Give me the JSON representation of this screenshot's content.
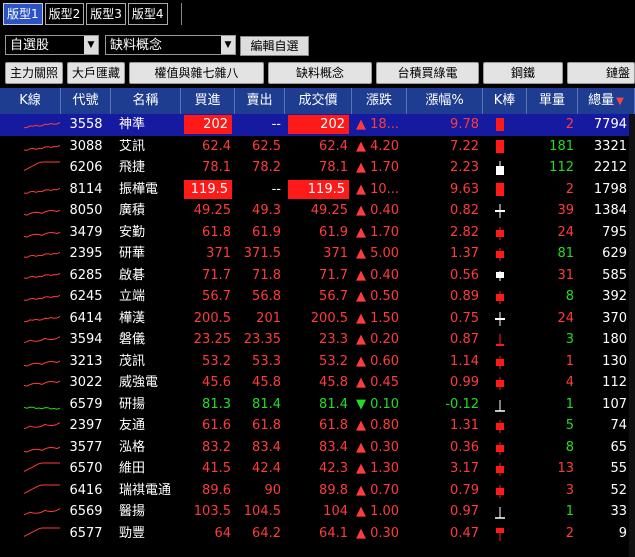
{
  "tabs": [
    "版型1",
    "版型2",
    "版型3",
    "版型4"
  ],
  "active_tab": 0,
  "selector": {
    "group": "自選股",
    "list": "缺料概念",
    "edit_label": "編輯自選"
  },
  "categories": [
    "主力關照",
    "大戶匯藏",
    "權值與雜七雜八",
    "缺料概念",
    "台積買綠電",
    "鋼鐵",
    "鏈盤"
  ],
  "columns": [
    "K線",
    "代號",
    "名稱",
    "買進",
    "賣出",
    "成交價",
    "漲跌",
    "漲幅%",
    "K棒",
    "單量",
    "總量"
  ],
  "sort_indicator": "▼",
  "colors": {
    "up": "#ff3b3b",
    "down": "#22dd22",
    "header": "#1e3d91",
    "selected": "#151aa0"
  },
  "rows": [
    {
      "code": "3558",
      "name": "神準",
      "bid": "202",
      "ask": "--",
      "last": "202",
      "chg": "▲ 18...",
      "pct": "9.78",
      "vol": "2",
      "total": "7794",
      "dir": "up",
      "limit": true,
      "kbar": "red-tall"
    },
    {
      "code": "3088",
      "name": "艾訊",
      "bid": "62.4",
      "ask": "62.5",
      "last": "62.4",
      "chg": "▲ 4.20",
      "pct": "7.22",
      "vol": "181",
      "total": "3321",
      "dir": "up",
      "volc": "green",
      "kbar": "red-tall"
    },
    {
      "code": "6206",
      "name": "飛捷",
      "bid": "78.1",
      "ask": "78.2",
      "last": "78.1",
      "chg": "▲ 1.70",
      "pct": "2.23",
      "vol": "112",
      "total": "2212",
      "dir": "up",
      "volc": "green",
      "kbar": "white-up"
    },
    {
      "code": "8114",
      "name": "振樺電",
      "bid": "119.5",
      "ask": "--",
      "last": "119.5",
      "chg": "▲ 10...",
      "pct": "9.63",
      "vol": "2",
      "total": "1798",
      "dir": "up",
      "limit": true,
      "kbar": "red-tall"
    },
    {
      "code": "8050",
      "name": "廣積",
      "bid": "49.25",
      "ask": "49.3",
      "last": "49.25",
      "chg": "▲ 0.40",
      "pct": "0.82",
      "vol": "39",
      "total": "1384",
      "dir": "up",
      "kbar": "white-cross"
    },
    {
      "code": "3479",
      "name": "安勤",
      "bid": "61.8",
      "ask": "61.9",
      "last": "61.9",
      "chg": "▲ 1.70",
      "pct": "2.82",
      "vol": "24",
      "total": "795",
      "dir": "up",
      "kbar": "red-mid"
    },
    {
      "code": "2395",
      "name": "研華",
      "bid": "371",
      "ask": "371.5",
      "last": "371",
      "chg": "▲ 5.00",
      "pct": "1.37",
      "vol": "81",
      "total": "629",
      "dir": "up",
      "volc": "green",
      "kbar": "red-mid"
    },
    {
      "code": "6285",
      "name": "啟碁",
      "bid": "71.7",
      "ask": "71.8",
      "last": "71.7",
      "chg": "▲ 0.40",
      "pct": "0.56",
      "vol": "31",
      "total": "585",
      "dir": "up",
      "kbar": "white-mid"
    },
    {
      "code": "6245",
      "name": "立端",
      "bid": "56.7",
      "ask": "56.8",
      "last": "56.7",
      "chg": "▲ 0.50",
      "pct": "0.89",
      "vol": "8",
      "total": "392",
      "dir": "up",
      "volc": "green",
      "kbar": "red-mid"
    },
    {
      "code": "6414",
      "name": "樺漢",
      "bid": "200.5",
      "ask": "201",
      "last": "200.5",
      "chg": "▲ 1.50",
      "pct": "0.75",
      "vol": "24",
      "total": "370",
      "dir": "up",
      "kbar": "white-cross"
    },
    {
      "code": "3594",
      "name": "磐儀",
      "bid": "23.25",
      "ask": "23.35",
      "last": "23.3",
      "chg": "▲ 0.20",
      "pct": "0.87",
      "vol": "3",
      "total": "180",
      "dir": "up",
      "volc": "green",
      "kbar": "red-thin"
    },
    {
      "code": "3213",
      "name": "茂訊",
      "bid": "53.2",
      "ask": "53.3",
      "last": "53.2",
      "chg": "▲ 0.60",
      "pct": "1.14",
      "vol": "1",
      "total": "130",
      "dir": "up",
      "kbar": "red-mid"
    },
    {
      "code": "3022",
      "name": "威強電",
      "bid": "45.6",
      "ask": "45.8",
      "last": "45.8",
      "chg": "▲ 0.45",
      "pct": "0.99",
      "vol": "4",
      "total": "112",
      "dir": "up",
      "kbar": "red-mid"
    },
    {
      "code": "6579",
      "name": "研揚",
      "bid": "81.3",
      "ask": "81.4",
      "last": "81.4",
      "chg": "▼ 0.10",
      "pct": "-0.12",
      "vol": "1",
      "total": "107",
      "dir": "down",
      "volc": "green",
      "kbar": "white-thin"
    },
    {
      "code": "2397",
      "name": "友通",
      "bid": "61.6",
      "ask": "61.8",
      "last": "61.8",
      "chg": "▲ 0.80",
      "pct": "1.31",
      "vol": "5",
      "total": "74",
      "dir": "up",
      "volc": "green",
      "kbar": "red-mid"
    },
    {
      "code": "3577",
      "name": "泓格",
      "bid": "83.2",
      "ask": "83.4",
      "last": "83.4",
      "chg": "▲ 0.30",
      "pct": "0.36",
      "vol": "8",
      "total": "65",
      "dir": "up",
      "volc": "green",
      "kbar": "red-mid"
    },
    {
      "code": "6570",
      "name": "維田",
      "bid": "41.5",
      "ask": "42.4",
      "last": "42.3",
      "chg": "▲ 1.30",
      "pct": "3.17",
      "vol": "13",
      "total": "55",
      "dir": "up",
      "kbar": "red-mid"
    },
    {
      "code": "6416",
      "name": "瑞祺電通",
      "bid": "89.6",
      "ask": "90",
      "last": "89.8",
      "chg": "▲ 0.70",
      "pct": "0.79",
      "vol": "3",
      "total": "52",
      "dir": "up",
      "kbar": "red-mid"
    },
    {
      "code": "6569",
      "name": "醫揚",
      "bid": "103.5",
      "ask": "104.5",
      "last": "104",
      "chg": "▲ 1.00",
      "pct": "0.97",
      "vol": "1",
      "total": "33",
      "dir": "up",
      "volc": "green",
      "kbar": "white-thin"
    },
    {
      "code": "6577",
      "name": "勁豐",
      "bid": "64",
      "ask": "64.2",
      "last": "64.1",
      "chg": "▲ 0.30",
      "pct": "0.47",
      "vol": "2",
      "total": "9",
      "dir": "up",
      "kbar": "red-flag"
    }
  ]
}
